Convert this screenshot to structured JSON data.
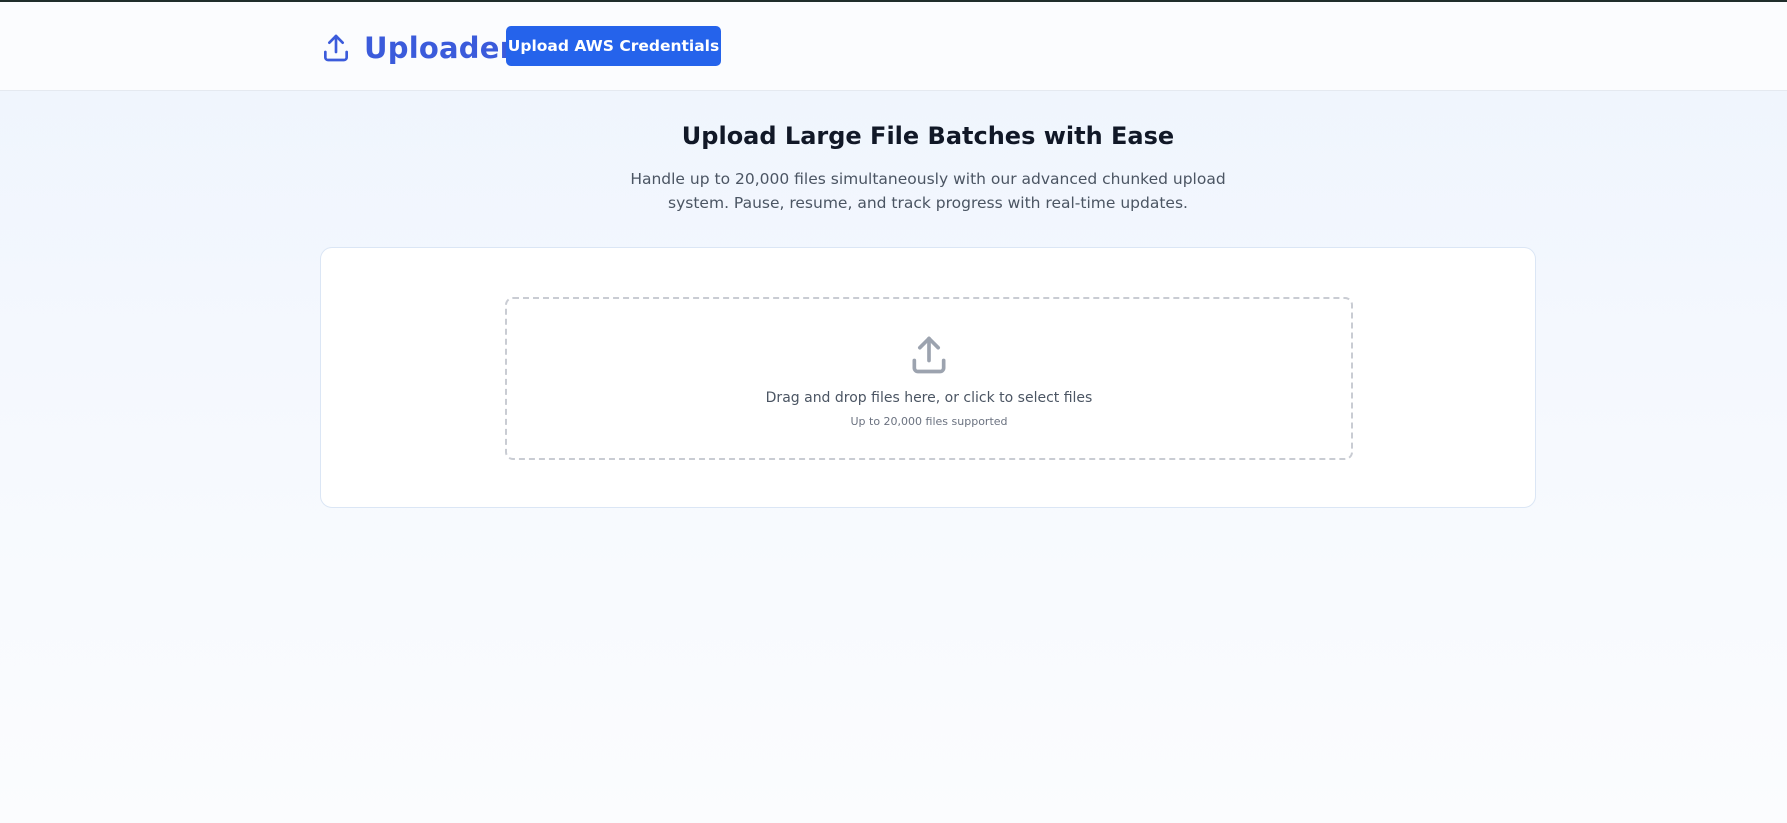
{
  "header": {
    "brand_icon": "upload-icon",
    "title": "Uploader",
    "aws_button_label": "Upload AWS Credentials",
    "accent_color": "#3b5bdb",
    "button_color": "#2563eb"
  },
  "hero": {
    "title": "Upload Large File Batches with Ease",
    "subtitle": "Handle up to 20,000 files simultaneously with our advanced chunked upload system. Pause, resume, and track progress with real-time updates."
  },
  "dropzone": {
    "icon": "upload-icon",
    "text": "Drag and drop files here, or click to select files",
    "hint": "Up to 20,000 files supported"
  }
}
